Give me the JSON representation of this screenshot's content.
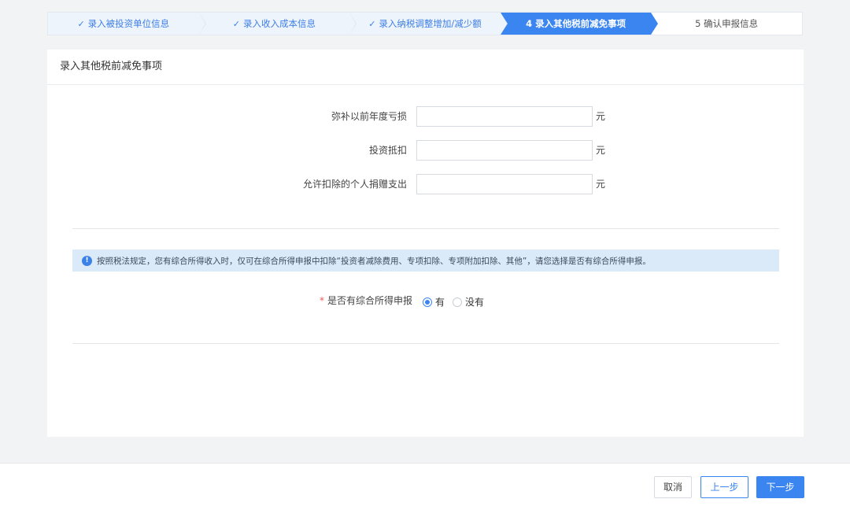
{
  "steps": [
    {
      "label": "录入被投资单位信息",
      "state": "done"
    },
    {
      "label": "录入收入成本信息",
      "state": "done"
    },
    {
      "label": "录入纳税调整增加/减少额",
      "state": "done"
    },
    {
      "label": "4 录入其他税前减免事项",
      "state": "active"
    },
    {
      "label": "5 确认申报信息",
      "state": "todo"
    }
  ],
  "card": {
    "title": "录入其他税前减免事项",
    "fields": [
      {
        "label": "弥补以前年度亏损",
        "value": "",
        "unit": "元"
      },
      {
        "label": "投资抵扣",
        "value": "",
        "unit": "元"
      },
      {
        "label": "允许扣除的个人捐赠支出",
        "value": "",
        "unit": "元"
      }
    ],
    "notice": "按照税法规定，您有综合所得收入时，仅可在综合所得申报中扣除“投资者减除费用、专项扣除、专项附加扣除、其他”，请您选择是否有综合所得申报。",
    "radio": {
      "required_mark": "*",
      "label": "是否有综合所得申报",
      "options": [
        "有",
        "没有"
      ],
      "selected": "有"
    }
  },
  "footer": {
    "cancel_label": "取消",
    "prev_label": "上一步",
    "next_label": "下一步"
  },
  "colors": {
    "accent": "#3a85ef",
    "step_done_bg": "#eef4fc",
    "notice_bg": "#dbeaf9"
  }
}
